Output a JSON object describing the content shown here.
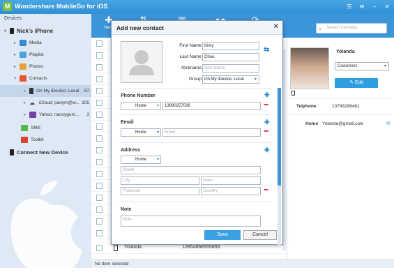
{
  "window": {
    "title": "Wondershare MobileGo for iOS",
    "logo_letter": "M"
  },
  "sidebar": {
    "header": "Devices",
    "device_name": "Nick's iPhone",
    "items": [
      {
        "label": "Media"
      },
      {
        "label": "Playlist"
      },
      {
        "label": "Photos"
      },
      {
        "label": "Contacts"
      }
    ],
    "sources": [
      {
        "label": "On My iDevice: Local",
        "count": "97"
      },
      {
        "label": "iCloud: panym@w...",
        "count": "305"
      },
      {
        "label": "Yahoo: nancygum...",
        "count": "3"
      }
    ],
    "sms": "SMS",
    "toolkit": "Toolkit",
    "connect": "Connect New Device"
  },
  "toolbar": {
    "new_label": "New"
  },
  "search": {
    "placeholder": "Search Contacts"
  },
  "list": {
    "last_row": {
      "name": "Yolanda",
      "number": "12854668555856"
    }
  },
  "detail": {
    "name": "Yolanda",
    "group": "Coworkers",
    "edit": "Edit",
    "tel_label": "Telphone",
    "tel_value": "13798288461",
    "home_label": "Home",
    "home_value": "Yolanda@gmail.com"
  },
  "status": {
    "text": "No item selected"
  },
  "dialog": {
    "title": "Add new contact",
    "labels": {
      "first": "First Name",
      "last": "Last Name",
      "nick": "Nickname",
      "group": "Group"
    },
    "values": {
      "first": "Kimy",
      "last": "Chou",
      "nick_ph": "Nick Name",
      "group": "On My iDevice: Local"
    },
    "phone_section": "Phone Number",
    "phone_type": "Home",
    "phone_value": "13890257036",
    "email_section": "Email",
    "email_type": "Home",
    "email_ph": "Email",
    "address_section": "Address",
    "address_type": "Home",
    "street_ph": "Street",
    "city_ph": "City",
    "state_ph": "State",
    "postcode_ph": "Postcode",
    "country_ph": "Country",
    "note_section": "Note",
    "note_ph": "Note",
    "save": "Save",
    "cancel": "Cancel"
  }
}
